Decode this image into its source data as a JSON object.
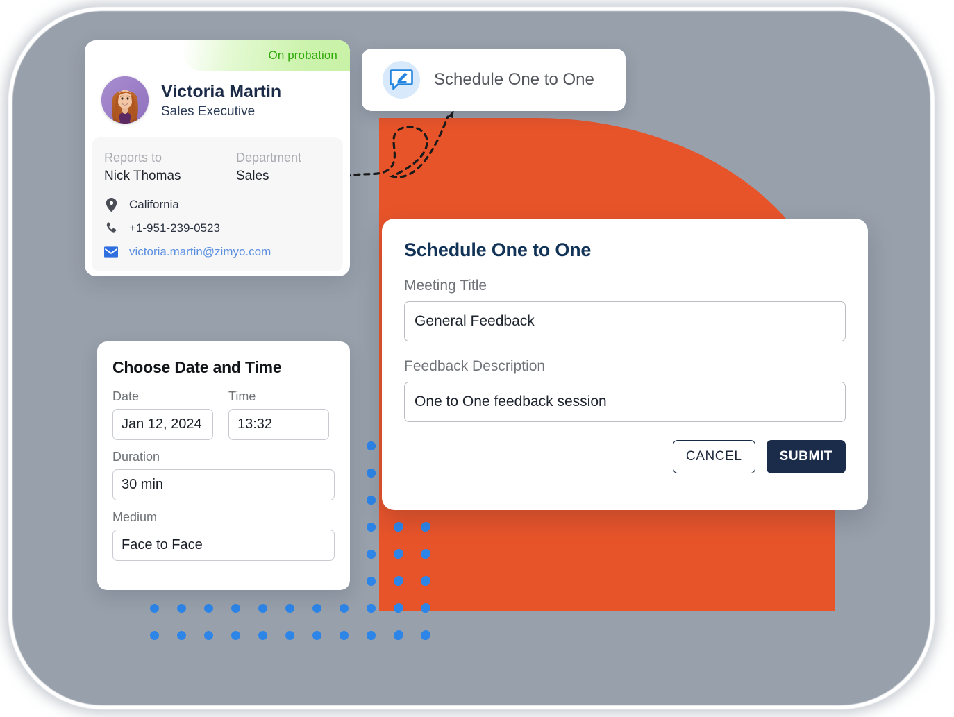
{
  "profile": {
    "badge": "On probation",
    "name": "Victoria Martin",
    "role": "Sales Executive",
    "reports_to_label": "Reports to",
    "reports_to_value": "Nick  Thomas",
    "department_label": "Department",
    "department_value": "Sales",
    "location": "California",
    "phone": "+1-951-239-0523",
    "email": "victoria.martin@zimyo.com",
    "icons": {
      "location": "location-pin-icon",
      "phone": "phone-icon",
      "email": "envelope-icon"
    },
    "colors": {
      "badge_text": "#2fa90a",
      "badge_bg": "#cdf3ae",
      "email_link": "#5b8fe0"
    }
  },
  "schedule_button": {
    "label": "Schedule One to One",
    "icon": "chat-edit-icon",
    "icon_color": "#2486e0",
    "icon_bg": "#d7e9fb"
  },
  "date_time_card": {
    "title": "Choose Date and Time",
    "fields": [
      {
        "label": "Date",
        "value": "Jan 12, 2024"
      },
      {
        "label": "Time",
        "value": "13:32"
      },
      {
        "label": "Duration",
        "value": "30 min"
      },
      {
        "label": "Medium",
        "value": "Face to Face"
      }
    ]
  },
  "dialog": {
    "title": "Schedule One to One",
    "meeting_title_label": "Meeting Title",
    "meeting_title_value": "General Feedback",
    "feedback_label": "Feedback Description",
    "feedback_value": "One to One feedback session",
    "cancel_label": "CANCEL",
    "submit_label": "SUBMIT",
    "submit_bg": "#1b2c4b",
    "title_color": "#123358"
  },
  "background": {
    "panel_color": "#98a0ab",
    "accent_color": "#e8542a",
    "dot_color": "#2d85e8"
  }
}
